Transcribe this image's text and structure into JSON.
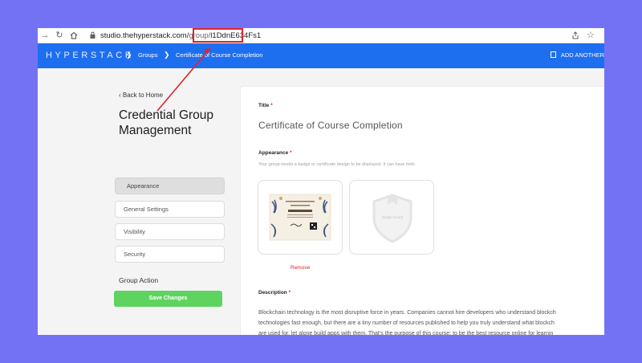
{
  "browser": {
    "url_host": "studio.thehyperstack.com/",
    "url_path": "group/",
    "url_id": "l1DdnE634Fs1",
    "back_icon": "arrow-left-icon",
    "forward_icon": "arrow-right-icon",
    "reload_icon": "reload-icon",
    "home_icon": "home-icon"
  },
  "header": {
    "logo": "HYPERSTACK",
    "crumb1": "Groups",
    "crumb2": "Certificate of Course Completion",
    "add_another": "ADD ANOTHER"
  },
  "sidebar": {
    "back": "Back to Home",
    "title": "Credential Group Management",
    "items": [
      "Appearance",
      "General Settings",
      "Visibility",
      "Security"
    ],
    "group_action": "Group Action",
    "save": "Save Changes"
  },
  "form": {
    "title_label": "Title",
    "title_value": "Certificate of Course Completion",
    "appearance_label": "Appearance",
    "appearance_hint": "Your group needs a badge or certificate design to be displayed. It can have both.",
    "badge_placeholder": "Badge Board",
    "remove": "Remove",
    "description_label": "Description",
    "required_mark": "*",
    "description_lines": [
      "Blockchain technology is the most disruptive force in years.  Companies cannot hire developers who understand blockch",
      "technologies fast enough, but there are a tiny number of resources published to help you truly understand what blockch",
      "are used for, let alone build apps with them.  That's the purpose of this course: to be the best resource online for learnin"
    ]
  },
  "colors": {
    "background": "#7472f4",
    "header": "#1e6ef0",
    "save_button": "#5fd35f",
    "annotation": "#e0242b"
  }
}
